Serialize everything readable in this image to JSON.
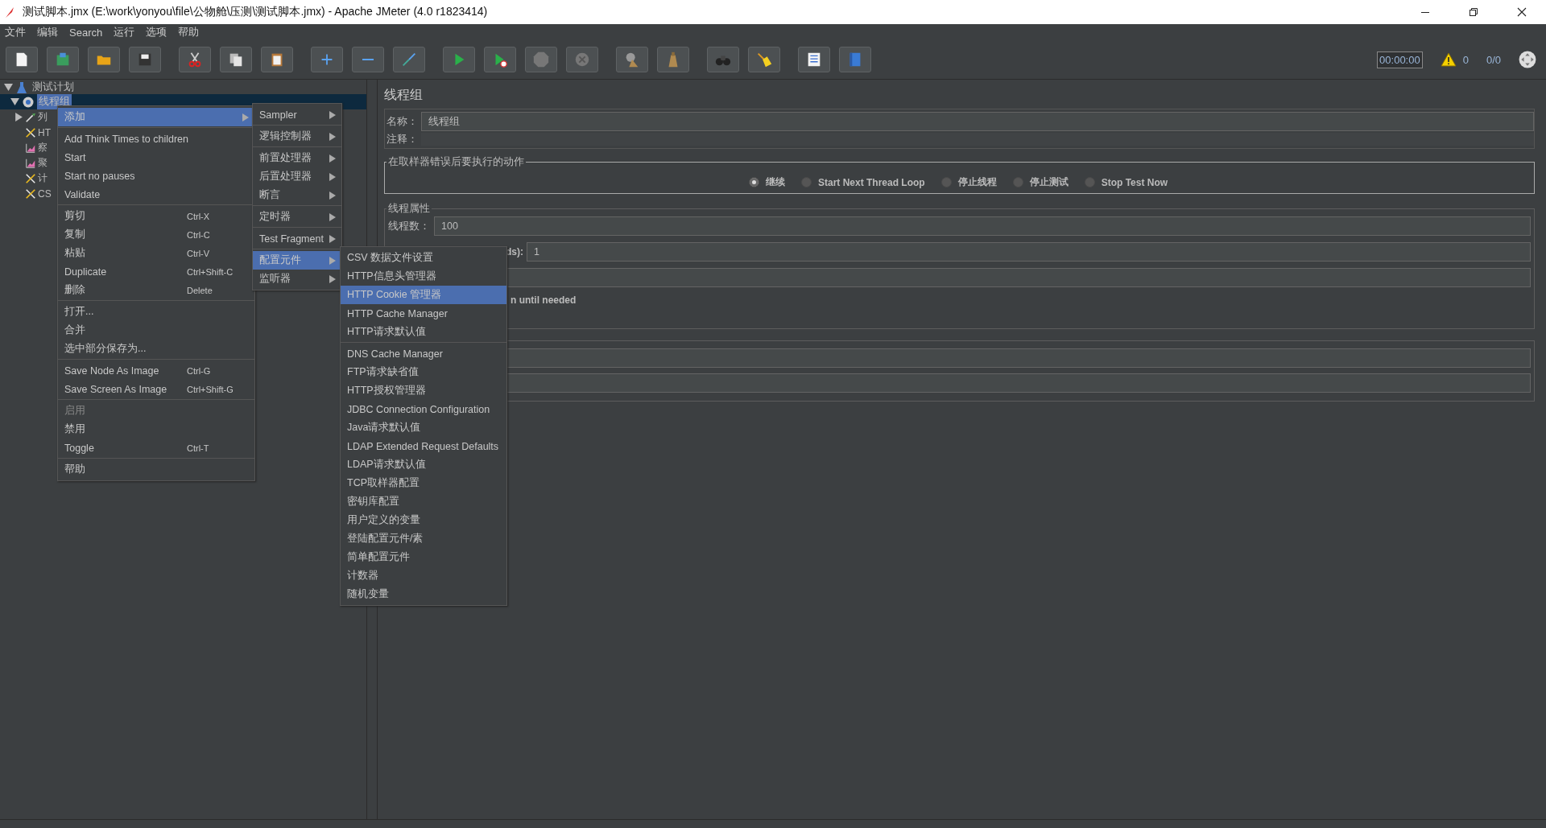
{
  "window": {
    "title": "测试脚本.jmx (E:\\work\\yonyou\\file\\公物舱\\压测\\测试脚本.jmx) - Apache JMeter (4.0 r1823414)"
  },
  "menu_bar": [
    "文件",
    "编辑",
    "Search",
    "运行",
    "选项",
    "帮助"
  ],
  "toolbar": {
    "timer": "00:00:00",
    "warnings": "0",
    "threads": "0/0"
  },
  "tree": [
    {
      "label": "测试计划",
      "kind": "plan",
      "expanded": true,
      "selected": false,
      "children": [
        {
          "label": "线程组",
          "kind": "threads",
          "expanded": true,
          "selected": true,
          "children": [
            {
              "label": "列",
              "kind": "pipette",
              "expanded": false,
              "selected": false
            },
            {
              "label": "HT",
              "kind": "tools",
              "selected": false
            },
            {
              "label": "察",
              "kind": "chart",
              "selected": false
            },
            {
              "label": "聚",
              "kind": "chart",
              "selected": false
            },
            {
              "label": "计",
              "kind": "tools",
              "selected": false
            },
            {
              "label": "CS",
              "kind": "tools",
              "selected": false
            }
          ]
        }
      ]
    }
  ],
  "context_menu": {
    "groups": [
      [
        {
          "label": "添加",
          "submenu": true,
          "selected": true,
          "disabled": false
        }
      ],
      [
        {
          "label": "Add Think Times to children",
          "submenu": false,
          "selected": false,
          "disabled": false
        },
        {
          "label": "Start",
          "submenu": false,
          "selected": false,
          "disabled": false
        },
        {
          "label": "Start no pauses",
          "submenu": false,
          "selected": false,
          "disabled": false
        },
        {
          "label": "Validate",
          "submenu": false,
          "selected": false,
          "disabled": false
        }
      ],
      [
        {
          "label": "剪切",
          "shortcut": "Ctrl-X",
          "submenu": false,
          "selected": false,
          "disabled": false
        },
        {
          "label": "复制",
          "shortcut": "Ctrl-C",
          "submenu": false,
          "selected": false,
          "disabled": false
        },
        {
          "label": "粘贴",
          "shortcut": "Ctrl-V",
          "submenu": false,
          "selected": false,
          "disabled": false
        },
        {
          "label": "Duplicate",
          "shortcut": "Ctrl+Shift-C",
          "submenu": false,
          "selected": false,
          "disabled": false
        },
        {
          "label": "删除",
          "shortcut": "Delete",
          "submenu": false,
          "selected": false,
          "disabled": false
        }
      ],
      [
        {
          "label": "打开...",
          "submenu": false,
          "selected": false,
          "disabled": false
        },
        {
          "label": "合并",
          "submenu": false,
          "selected": false,
          "disabled": false
        },
        {
          "label": "选中部分保存为...",
          "submenu": false,
          "selected": false,
          "disabled": false
        }
      ],
      [
        {
          "label": "Save Node As Image",
          "shortcut": "Ctrl-G",
          "submenu": false,
          "selected": false,
          "disabled": false
        },
        {
          "label": "Save Screen As Image",
          "shortcut": "Ctrl+Shift-G",
          "submenu": false,
          "selected": false,
          "disabled": false
        }
      ],
      [
        {
          "label": "启用",
          "submenu": false,
          "selected": false,
          "disabled": true
        },
        {
          "label": "禁用",
          "submenu": false,
          "selected": false,
          "disabled": false
        },
        {
          "label": "Toggle",
          "shortcut": "Ctrl-T",
          "submenu": false,
          "selected": false,
          "disabled": false
        }
      ],
      [
        {
          "label": "帮助",
          "submenu": false,
          "selected": false,
          "disabled": false
        }
      ]
    ]
  },
  "add_submenu": {
    "groups": [
      [
        {
          "label": "Sampler",
          "submenu": true,
          "selected": false
        }
      ],
      [
        {
          "label": "逻辑控制器",
          "submenu": true,
          "selected": false
        }
      ],
      [
        {
          "label": "前置处理器",
          "submenu": true,
          "selected": false
        },
        {
          "label": "后置处理器",
          "submenu": true,
          "selected": false
        },
        {
          "label": "断言",
          "submenu": true,
          "selected": false
        }
      ],
      [
        {
          "label": "定时器",
          "submenu": true,
          "selected": false
        }
      ],
      [
        {
          "label": "Test Fragment",
          "submenu": true,
          "selected": false
        }
      ],
      [
        {
          "label": "配置元件",
          "submenu": true,
          "selected": true
        },
        {
          "label": "监听器",
          "submenu": true,
          "selected": false
        }
      ]
    ]
  },
  "config_submenu": {
    "groups": [
      [
        {
          "label": "CSV 数据文件设置",
          "selected": false
        },
        {
          "label": "HTTP信息头管理器",
          "selected": false
        },
        {
          "label": "HTTP Cookie 管理器",
          "selected": true
        },
        {
          "label": "HTTP Cache Manager",
          "selected": false
        },
        {
          "label": "HTTP请求默认值",
          "selected": false
        }
      ],
      [
        {
          "label": "DNS Cache Manager",
          "selected": false
        },
        {
          "label": "FTP请求缺省值",
          "selected": false
        },
        {
          "label": "HTTP授权管理器",
          "selected": false
        },
        {
          "label": "JDBC Connection Configuration",
          "selected": false
        },
        {
          "label": "Java请求默认值",
          "selected": false
        },
        {
          "label": "LDAP Extended Request Defaults",
          "selected": false
        },
        {
          "label": "LDAP请求默认值",
          "selected": false
        },
        {
          "label": "TCP取样器配置",
          "selected": false
        },
        {
          "label": "密钥库配置",
          "selected": false
        },
        {
          "label": "用户定义的变量",
          "selected": false
        },
        {
          "label": "登陆配置元件/素",
          "selected": false
        },
        {
          "label": "简单配置元件",
          "selected": false
        },
        {
          "label": "计数器",
          "selected": false
        },
        {
          "label": "随机变量",
          "selected": false
        }
      ]
    ]
  },
  "panel": {
    "title": "线程组",
    "name_label": "名称：",
    "name_value": "线程组",
    "comment_label": "注释：",
    "on_error": {
      "legend": "在取样器错误后要执行的动作",
      "options": [
        {
          "label": "继续",
          "selected": true
        },
        {
          "label": "Start Next Thread Loop",
          "selected": false
        },
        {
          "label": "停止线程",
          "selected": false
        },
        {
          "label": "停止测试",
          "selected": false
        },
        {
          "label": "Stop Test Now",
          "selected": false
        }
      ]
    },
    "thread_properties": {
      "legend": "线程属性",
      "threads_label": "线程数：",
      "threads_value": "100",
      "ramp_label": "ds):",
      "ramp_value": "1",
      "delay_label": "n until needed"
    }
  }
}
